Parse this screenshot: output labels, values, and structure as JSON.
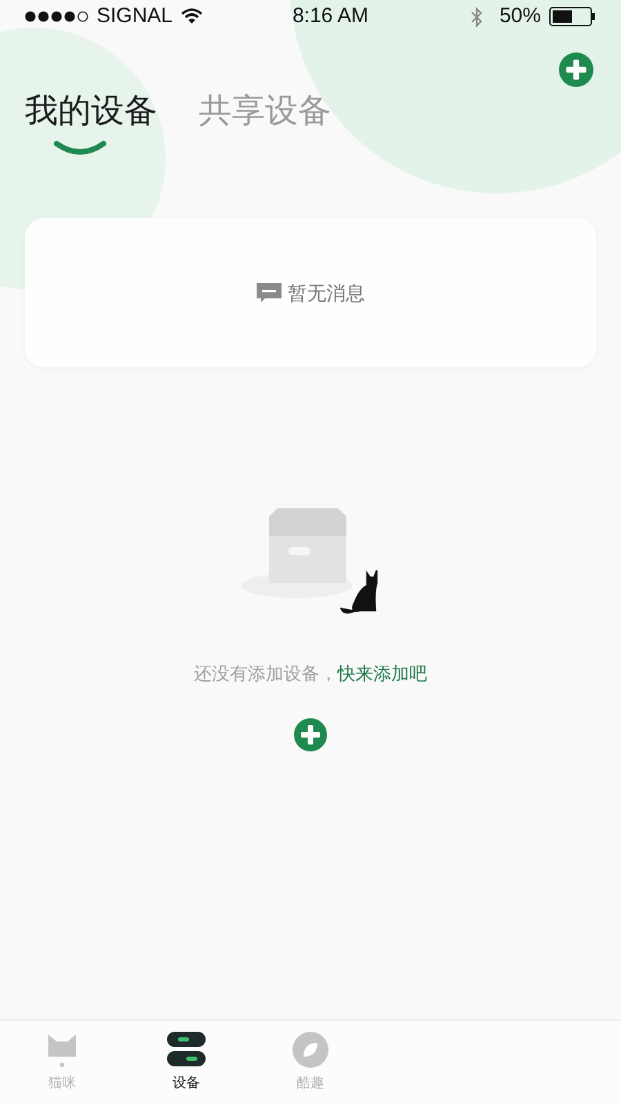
{
  "status_bar": {
    "carrier": "SIGNAL",
    "time": "8:16 AM",
    "battery": "50%"
  },
  "tabs": [
    {
      "label": "我的设备",
      "selected": true
    },
    {
      "label": "共享设备",
      "selected": false
    }
  ],
  "messages": {
    "empty_text": "暂无消息"
  },
  "empty_state": {
    "text": "还没有添加设备，",
    "link": "快来添加吧"
  },
  "bottom_nav": [
    {
      "kind": "cat",
      "label": "猫咪",
      "selected": false
    },
    {
      "kind": "device",
      "label": "设备",
      "selected": true
    },
    {
      "kind": "leaf",
      "label": "酷趣",
      "selected": false
    }
  ]
}
